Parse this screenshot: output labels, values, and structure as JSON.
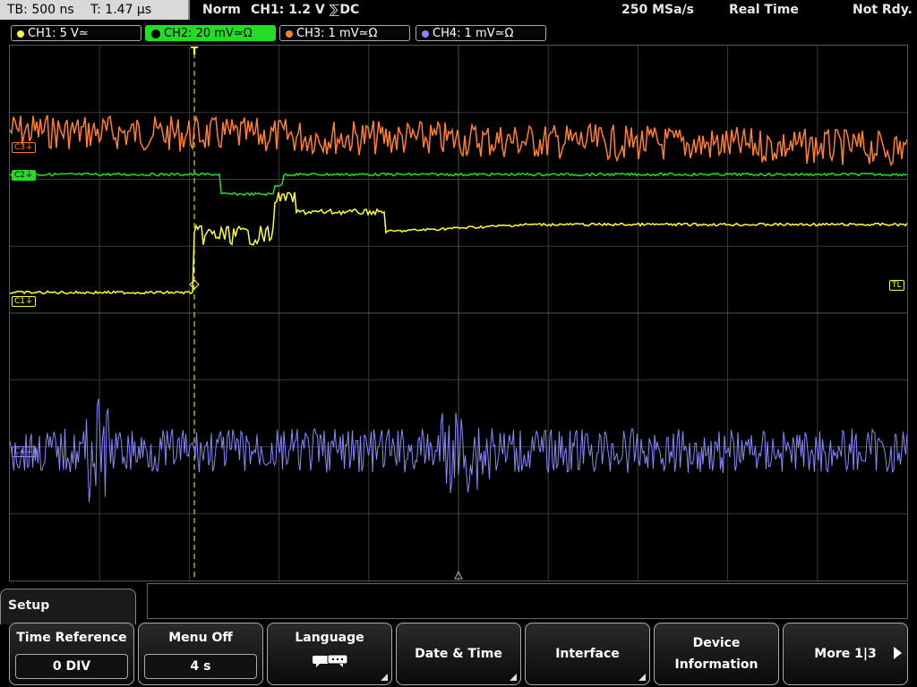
{
  "topbar": {
    "timebase": "TB: 500 ns",
    "trigger_time": "T: 1.47 µs",
    "mode": "Norm",
    "trigger": "CH1: 1.2 V ⅀DC",
    "sample_rate": "250 MSa/s",
    "acq_mode": "Real Time",
    "status": "Not Rdy."
  },
  "channels": [
    {
      "label": "CH1: 5 V≃",
      "color": "#ffff33",
      "active": false
    },
    {
      "label": "CH2: 20 mV≃Ω",
      "color": "#22dd22",
      "active": true
    },
    {
      "label": "CH3: 1 mV≃Ω",
      "color": "#ff7f2a",
      "active": false
    },
    {
      "label": "CH4: 1 mV≃Ω",
      "color": "#8888ff",
      "active": false
    }
  ],
  "markers": {
    "c3": "C3⏚",
    "c2": "C2⏚",
    "c1": "C1⏚",
    "c4": "C4⏚",
    "tl": "TL",
    "trigger_t": "T"
  },
  "setup": {
    "title": "Setup"
  },
  "softkeys": [
    {
      "label": "Time Reference",
      "value": "0 DIV"
    },
    {
      "label": "Menu Off",
      "value": "4 s"
    },
    {
      "label": "Language",
      "icon": "speech-bubbles-icon"
    },
    {
      "label": "Date & Time"
    },
    {
      "label": "Interface"
    },
    {
      "label": "Device\nInformation"
    },
    {
      "label": "More 1|3"
    }
  ]
}
